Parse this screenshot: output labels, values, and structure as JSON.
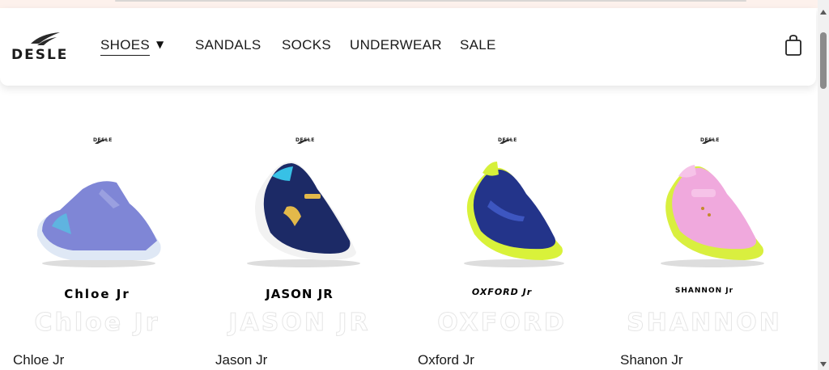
{
  "brand": {
    "name": "DESLE"
  },
  "nav": {
    "items": [
      {
        "label": "SHOES",
        "active": true,
        "has_dropdown": true
      },
      {
        "label": "SANDALS"
      },
      {
        "label": "SOCKS"
      },
      {
        "label": "UNDERWEAR"
      },
      {
        "label": "SALE"
      }
    ],
    "cart_icon": "shopping-bag-icon"
  },
  "products": [
    {
      "title": "Chloe Jr",
      "model_label": "Chloe Jr",
      "watermark": "Chloe Jr",
      "colors": {
        "body": "#7f86d6",
        "accent": "#5fb4e0",
        "sole": "#dfe8f5"
      }
    },
    {
      "title": "Jason Jr",
      "model_label": "JASON JR",
      "watermark": "JASON JR",
      "colors": {
        "body": "#1c2a66",
        "accent": "#37c1e6",
        "sole": "#f2f2f2"
      }
    },
    {
      "title": "Oxford Jr",
      "model_label": "OXFORD Jr",
      "watermark": "OXFORD",
      "colors": {
        "body": "#23348a",
        "accent": "#d6f03a",
        "sole": "#d9f23a"
      }
    },
    {
      "title": "Shanon Jr",
      "model_label": "SHANNON Jr",
      "watermark": "SHANNON",
      "colors": {
        "body": "#f0a9dd",
        "accent": "#d9ef3f",
        "sole": "#f3f3f3"
      }
    }
  ]
}
